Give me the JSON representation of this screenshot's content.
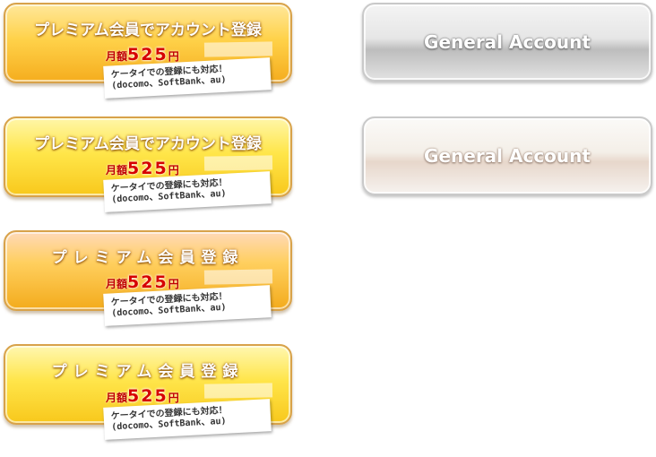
{
  "premium_buttons": [
    {
      "title": "プレミアム会員でアカウント登録",
      "price_label": "月額",
      "price": "525",
      "price_unit": "円",
      "note_line1": "ケータイでの登録にも対応！",
      "note_line2": "(docomo、SoftBank、au)"
    },
    {
      "title": "プレミアム会員でアカウント登録",
      "price_label": "月額",
      "price": "525",
      "price_unit": "円",
      "note_line1": "ケータイでの登録にも対応！",
      "note_line2": "(docomo、SoftBank、au)"
    },
    {
      "title": "プレミアム会員登録",
      "price_label": "月額",
      "price": "525",
      "price_unit": "円",
      "note_line1": "ケータイでの登録にも対応！",
      "note_line2": "(docomo、SoftBank、au)"
    },
    {
      "title": "プレミアム会員登録",
      "price_label": "月額",
      "price": "525",
      "price_unit": "円",
      "note_line1": "ケータイでの登録にも対応！",
      "note_line2": "(docomo、SoftBank、au)"
    }
  ],
  "general_buttons": [
    {
      "label": "General Account"
    },
    {
      "label": "General Account"
    }
  ],
  "colors": {
    "price_red": "#d60000",
    "premium_gold": "#ffd24a",
    "general_silver": "#d8d8d8"
  }
}
